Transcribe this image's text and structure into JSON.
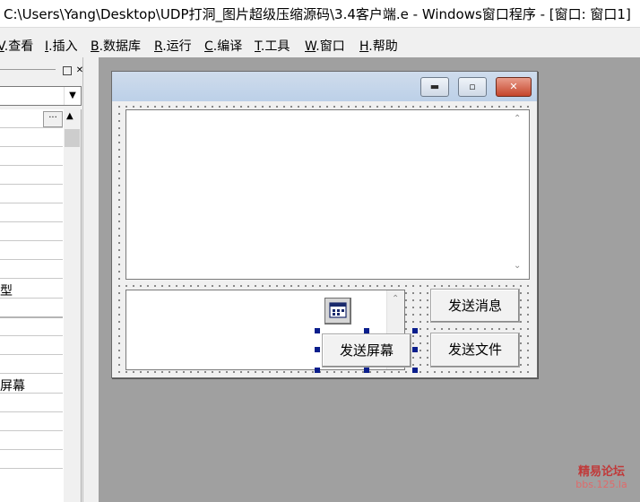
{
  "window": {
    "title": "C:\\Users\\Yang\\Desktop\\UDP打洞_图片超级压缩源码\\3.4客户端.e - Windows窗口程序 - [窗口: 窗口1]"
  },
  "menu": [
    {
      "key": "V",
      "label": ".查看"
    },
    {
      "key": "I",
      "label": ".插入"
    },
    {
      "key": "B",
      "label": ".数据库"
    },
    {
      "key": "R",
      "label": ".运行"
    },
    {
      "key": "C",
      "label": ".编译"
    },
    {
      "key": "T",
      "label": ".工具"
    },
    {
      "key": "W",
      "label": ".窗口"
    },
    {
      "key": "H",
      "label": ".帮助"
    }
  ],
  "left_panel": {
    "combo_arrow": "▼",
    "ellipsis": "···",
    "row_texts": [
      "型",
      "屏幕"
    ]
  },
  "form": {
    "buttons": {
      "send_message": "发送消息",
      "send_file": "发送文件",
      "send_screen": "发送屏幕"
    }
  },
  "watermark": {
    "line1": "精易论坛",
    "line2": "bbs.125.la"
  }
}
